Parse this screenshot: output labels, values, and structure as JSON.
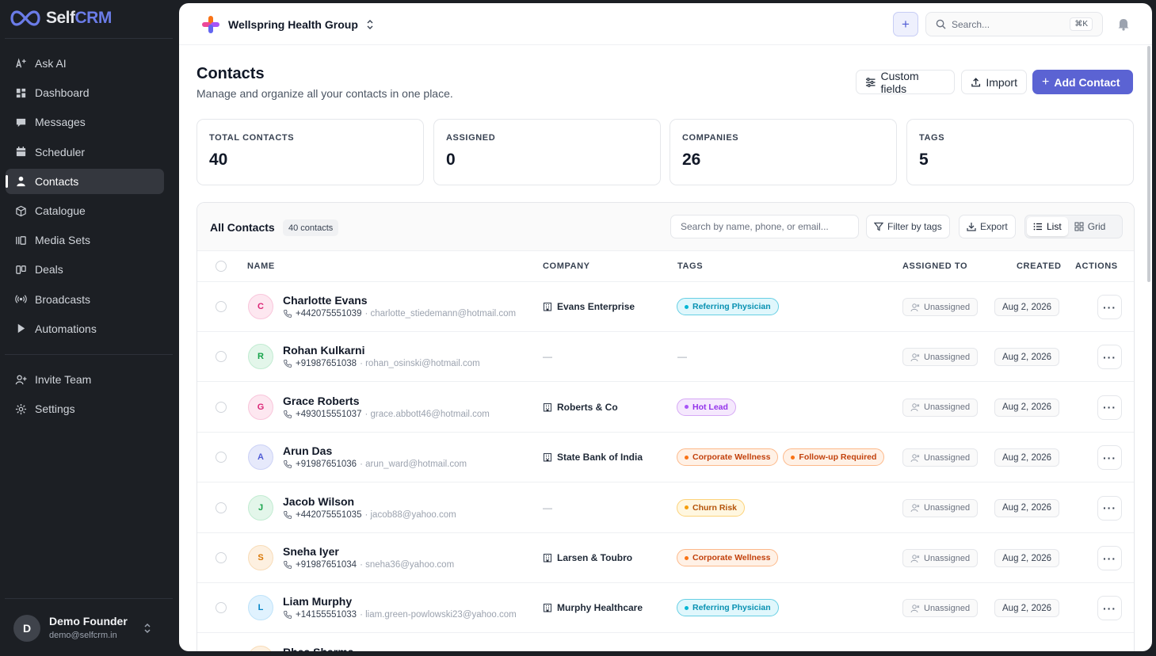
{
  "app": {
    "brand_self": "Self",
    "brand_crm": "CRM"
  },
  "sidebar": {
    "items": [
      {
        "label": "Ask AI",
        "icon": "sparkle-icon"
      },
      {
        "label": "Dashboard",
        "icon": "dashboard-icon"
      },
      {
        "label": "Messages",
        "icon": "messages-icon"
      },
      {
        "label": "Scheduler",
        "icon": "calendar-icon"
      },
      {
        "label": "Contacts",
        "icon": "user-icon",
        "active": true
      },
      {
        "label": "Catalogue",
        "icon": "box-icon"
      },
      {
        "label": "Media Sets",
        "icon": "media-icon"
      },
      {
        "label": "Deals",
        "icon": "deals-icon"
      },
      {
        "label": "Broadcasts",
        "icon": "broadcast-icon"
      },
      {
        "label": "Automations",
        "icon": "play-icon"
      }
    ],
    "secondary": [
      {
        "label": "Invite Team",
        "icon": "user-plus-icon"
      },
      {
        "label": "Settings",
        "icon": "gear-icon"
      }
    ],
    "user": {
      "initial": "D",
      "name": "Demo Founder",
      "email": "demo@selfcrm.in"
    }
  },
  "topbar": {
    "org_name": "Wellspring Health Group",
    "search_placeholder": "Search...",
    "search_shortcut": "⌘K"
  },
  "page": {
    "title": "Contacts",
    "subtitle": "Manage and organize all your contacts in one place.",
    "custom_fields_label": "Custom fields",
    "import_label": "Import",
    "add_label": "Add Contact"
  },
  "stats": [
    {
      "label": "TOTAL CONTACTS",
      "value": "40"
    },
    {
      "label": "ASSIGNED",
      "value": "0"
    },
    {
      "label": "COMPANIES",
      "value": "26"
    },
    {
      "label": "TAGS",
      "value": "5"
    }
  ],
  "table": {
    "title": "All Contacts",
    "count": "40 contacts",
    "search_placeholder": "Search by name, phone, or email...",
    "filter_label": "Filter by tags",
    "export_label": "Export",
    "list_label": "List",
    "grid_label": "Grid",
    "columns": {
      "name": "NAME",
      "company": "COMPANY",
      "tags": "TAGS",
      "assigned": "ASSIGNED TO",
      "created": "CREATED",
      "actions": "ACTIONS"
    },
    "dash": "—",
    "rows": [
      {
        "initial": "C",
        "name": "Charlotte Evans",
        "phone": "+442075551039",
        "email": "· charlotte_stiedemann@hotmail.com",
        "company": "Evans Enterprise",
        "tags": [
          "Referring Physician"
        ],
        "assigned": "Unassigned",
        "created": "Aug 2, 2026"
      },
      {
        "initial": "R",
        "name": "Rohan Kulkarni",
        "phone": "+91987651038",
        "email": "· rohan_osinski@hotmail.com",
        "company": "",
        "tags": [],
        "assigned": "Unassigned",
        "created": "Aug 2, 2026"
      },
      {
        "initial": "G",
        "name": "Grace Roberts",
        "phone": "+493015551037",
        "email": "· grace.abbott46@hotmail.com",
        "company": "Roberts & Co",
        "tags": [
          "Hot Lead"
        ],
        "assigned": "Unassigned",
        "created": "Aug 2, 2026"
      },
      {
        "initial": "A",
        "name": "Arun Das",
        "phone": "+91987651036",
        "email": "· arun_ward@hotmail.com",
        "company": "State Bank of India",
        "tags": [
          "Corporate Wellness",
          "Follow-up Required"
        ],
        "assigned": "Unassigned",
        "created": "Aug 2, 2026"
      },
      {
        "initial": "J",
        "name": "Jacob Wilson",
        "phone": "+442075551035",
        "email": "· jacob88@yahoo.com",
        "company": "",
        "tags": [
          "Churn Risk"
        ],
        "assigned": "Unassigned",
        "created": "Aug 2, 2026"
      },
      {
        "initial": "S",
        "name": "Sneha Iyer",
        "phone": "+91987651034",
        "email": "· sneha36@yahoo.com",
        "company": "Larsen & Toubro",
        "tags": [
          "Corporate Wellness"
        ],
        "assigned": "Unassigned",
        "created": "Aug 2, 2026"
      },
      {
        "initial": "L",
        "name": "Liam Murphy",
        "phone": "+14155551033",
        "email": "· liam.green-powlowski23@yahoo.com",
        "company": "Murphy Healthcare",
        "tags": [
          "Referring Physician"
        ],
        "assigned": "Unassigned",
        "created": "Aug 2, 2026"
      },
      {
        "initial": "R",
        "name": "Rhea Sharma",
        "phone": "",
        "email": "",
        "company": "",
        "tags": [],
        "assigned": "",
        "created": ""
      }
    ]
  },
  "colors": {
    "accent": "#5b63d3",
    "avatars": [
      {
        "bg": "#fde7f0",
        "fg": "#db2777",
        "border": "#f9c6db"
      },
      {
        "bg": "#e3f6ea",
        "fg": "#16a34a",
        "border": "#c2ecd2"
      },
      {
        "bg": "#fde7f0",
        "fg": "#db2777",
        "border": "#f9c6db"
      },
      {
        "bg": "#e6e9fb",
        "fg": "#4f5bd5",
        "border": "#ccd2f6"
      },
      {
        "bg": "#e3f6ea",
        "fg": "#16a34a",
        "border": "#c2ecd2"
      },
      {
        "bg": "#fdf0e0",
        "fg": "#d97706",
        "border": "#f8dcb8"
      },
      {
        "bg": "#e0f2fe",
        "fg": "#0284c7",
        "border": "#bfe3f9"
      },
      {
        "bg": "#fdf0e0",
        "fg": "#d97706",
        "border": "#f8dcb8"
      }
    ],
    "tags": {
      "Referring Physician": {
        "bg": "#e0f7fc",
        "fg": "#0891b2",
        "border": "#67cfe4",
        "dot": "#06b6d4"
      },
      "Hot Lead": {
        "bg": "#f5e8fd",
        "fg": "#9333ea",
        "border": "#d6a8f5",
        "dot": "#a855f7"
      },
      "Corporate Wellness": {
        "bg": "#fff1e6",
        "fg": "#c2410c",
        "border": "#fdb98a",
        "dot": "#f97316"
      },
      "Follow-up Required": {
        "bg": "#fff1e6",
        "fg": "#c2410c",
        "border": "#fdb98a",
        "dot": "#f97316"
      },
      "Churn Risk": {
        "bg": "#fff7e0",
        "fg": "#b45309",
        "border": "#fcd37a",
        "dot": "#f59e0b"
      }
    }
  }
}
